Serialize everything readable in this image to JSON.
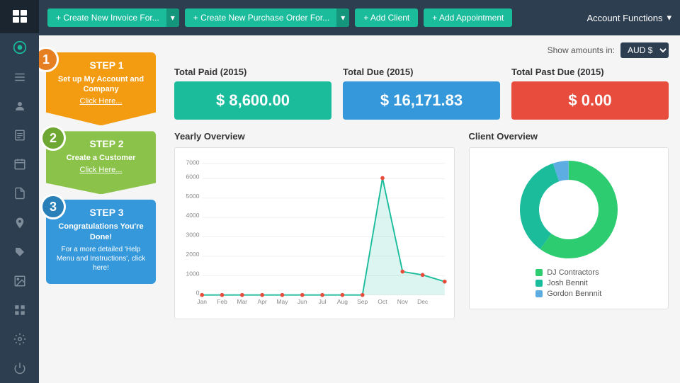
{
  "topbar": {
    "btn1": "+ Create New Invoice For...",
    "btn2": "+ Create New Purchase Order For...",
    "btn3": "+ Add Client",
    "btn4": "+ Add Appointment",
    "account_functions": "Account Functions"
  },
  "show_amounts": {
    "label": "Show amounts in:",
    "currency": "AUD $"
  },
  "stats": {
    "paid": {
      "label": "Total Paid (2015)",
      "value": "$ 8,600.00"
    },
    "due": {
      "label": "Total Due (2015)",
      "value": "$ 16,171.83"
    },
    "past_due": {
      "label": "Total Past Due (2015)",
      "value": "$ 0.00"
    }
  },
  "yearly_chart": {
    "title": "Yearly Overview",
    "x_labels": [
      "Jan",
      "Feb",
      "Mar",
      "Apr",
      "May",
      "Jun",
      "Jul",
      "Aug",
      "Sep",
      "Oct",
      "Nov",
      "Dec"
    ],
    "y_labels": [
      "0",
      "1000",
      "2000",
      "3000",
      "4000",
      "5000",
      "6000",
      "7000"
    ]
  },
  "client_chart": {
    "title": "Client Overview",
    "legend": [
      {
        "label": "DJ Contractors",
        "color": "#2ecc71"
      },
      {
        "label": "Josh Bennit",
        "color": "#1abc9c"
      },
      {
        "label": "Gordon Bennnit",
        "color": "#5dade2"
      }
    ]
  },
  "steps": {
    "step1": {
      "badge": "1",
      "title": "STEP 1",
      "desc": "Set up My Account and Company",
      "link": "Click Here..."
    },
    "step2": {
      "badge": "2",
      "title": "STEP 2",
      "desc": "Create a Customer",
      "link": "Click Here..."
    },
    "step3": {
      "badge": "3",
      "title": "STEP 3",
      "desc": "Congratulations You're Done!",
      "extra": "For a more detailed 'Help Menu and Instructions', click here!",
      "link": ""
    }
  },
  "sidebar": {
    "items": [
      {
        "icon": "☰",
        "name": "menu"
      },
      {
        "icon": "⊕",
        "name": "dashboard"
      },
      {
        "icon": "≡",
        "name": "invoices"
      },
      {
        "icon": "👤",
        "name": "clients"
      },
      {
        "icon": "📋",
        "name": "orders"
      },
      {
        "icon": "📅",
        "name": "calendar"
      },
      {
        "icon": "◧",
        "name": "documents"
      },
      {
        "icon": "📍",
        "name": "locations"
      },
      {
        "icon": "🏷",
        "name": "tags"
      },
      {
        "icon": "🖼",
        "name": "gallery"
      },
      {
        "icon": "⊞",
        "name": "grid"
      },
      {
        "icon": "⚙",
        "name": "settings"
      },
      {
        "icon": "⏻",
        "name": "power"
      }
    ]
  }
}
